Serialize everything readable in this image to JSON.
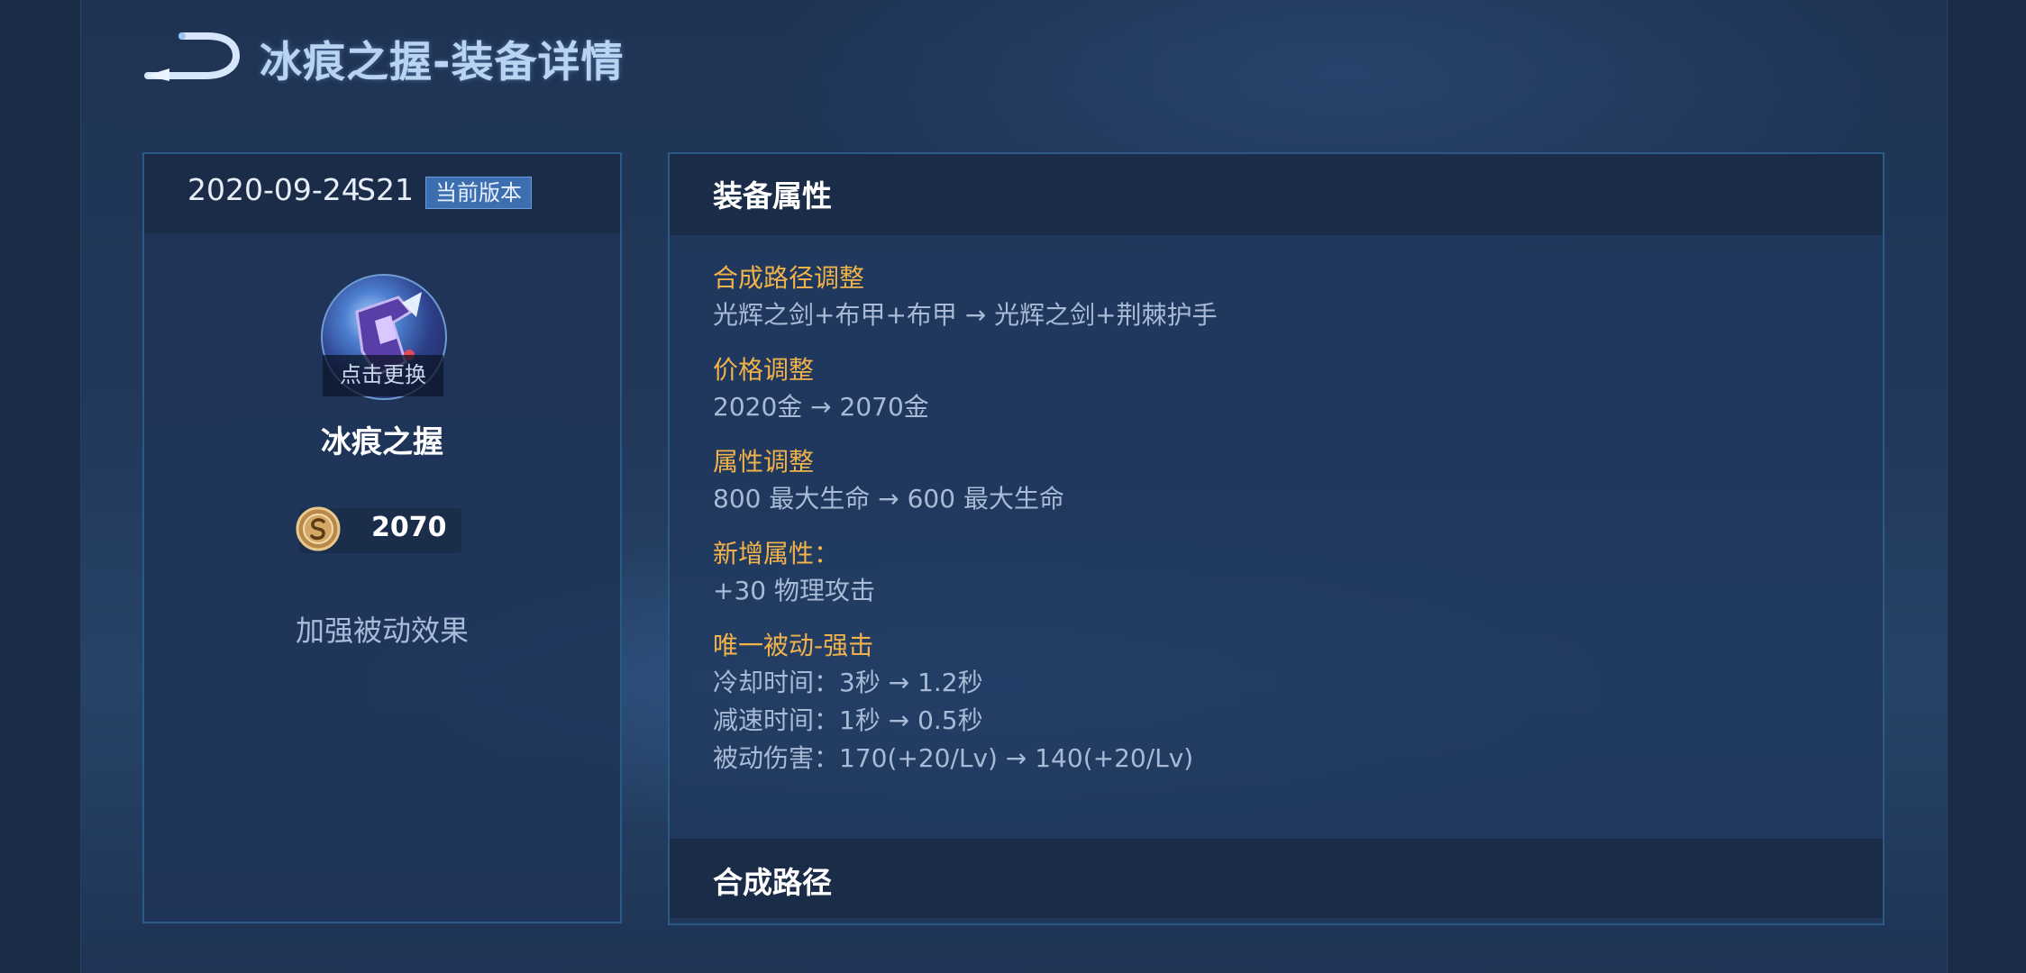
{
  "page": {
    "title": "冰痕之握-装备详情"
  },
  "version": {
    "date": "2020-09-24",
    "season": "S21",
    "badge": "当前版本"
  },
  "item": {
    "name": "冰痕之握",
    "change_label": "点击更换",
    "price": "2070",
    "passive_note": "加强被动效果"
  },
  "attributes": {
    "title": "装备属性",
    "sections": [
      {
        "heading": "合成路径调整",
        "lines": [
          "光辉之剑+布甲+布甲 → 光辉之剑+荆棘护手"
        ]
      },
      {
        "heading": "价格调整",
        "lines": [
          "2020金 → 2070金"
        ]
      },
      {
        "heading": "属性调整",
        "lines": [
          "800 最大生命 → 600 最大生命"
        ]
      },
      {
        "heading": "新增属性：",
        "lines": [
          "+30 物理攻击"
        ]
      },
      {
        "heading": "唯一被动-强击",
        "lines": [
          "冷却时间：3秒 → 1.2秒",
          "减速时间：1秒 → 0.5秒",
          "被动伤害：170(+20/Lv) → 140(+20/Lv)"
        ]
      }
    ]
  },
  "recipe": {
    "title": "合成路径"
  },
  "colors": {
    "accent_heading": "#f0b24a",
    "title": "#b9d3f3",
    "badge": "#3d6fb0"
  }
}
